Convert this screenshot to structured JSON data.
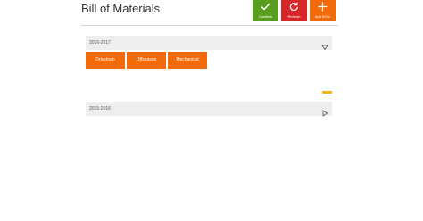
{
  "header": {
    "title": "Bill of Materials"
  },
  "toolbar": {
    "conflicts": {
      "label": "Conflicts",
      "icon": "check-icon",
      "color": "#5a9e1f"
    },
    "refresh": {
      "label": "Refresh",
      "icon": "refresh-icon",
      "color": "#d8272b"
    },
    "add_bom": {
      "label": "Add BOM",
      "icon": "plus-icon",
      "color": "#f26b0b"
    }
  },
  "seasons": [
    {
      "label": "2016-2017",
      "expanded": true,
      "chevron_icon": "chevron-down-icon",
      "categories": [
        "Drivetrain",
        "Offseason",
        "Mechanical"
      ]
    },
    {
      "label": "2015-2016",
      "expanded": false,
      "chevron_icon": "chevron-right-icon",
      "categories": []
    }
  ],
  "colors": {
    "accent": "#f26b0b",
    "loading": "#f2b600",
    "panel": "#eeeeee"
  }
}
